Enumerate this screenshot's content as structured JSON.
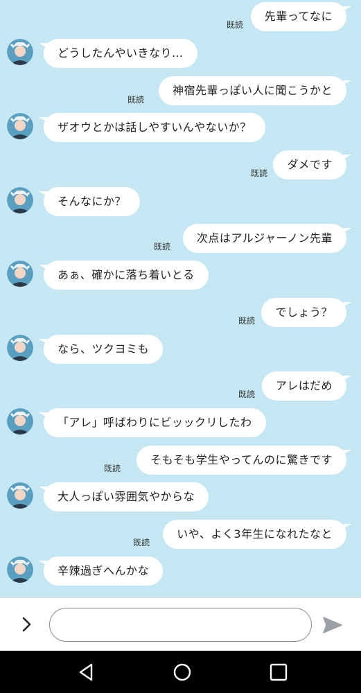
{
  "read_label": "既読",
  "messages": [
    {
      "side": "sent",
      "text": "先輩ってなに"
    },
    {
      "side": "recv",
      "text": "どうしたんやいきなり…"
    },
    {
      "side": "sent",
      "text": "神宿先輩っぽい人に聞こうかと"
    },
    {
      "side": "recv",
      "text": "ザオウとかは話しやすいんやないか？"
    },
    {
      "side": "sent",
      "text": "ダメです"
    },
    {
      "side": "recv",
      "text": "そんなにか？"
    },
    {
      "side": "sent",
      "text": "次点はアルジャーノン先輩"
    },
    {
      "side": "recv",
      "text": "あぁ、確かに落ち着いとる"
    },
    {
      "side": "sent",
      "text": "でしょう？"
    },
    {
      "side": "recv",
      "text": "なら、ツクヨミも"
    },
    {
      "side": "sent",
      "text": "アレはだめ"
    },
    {
      "side": "recv",
      "text": "「アレ」呼ばわりにビッックリしたわ"
    },
    {
      "side": "sent",
      "text": "そもそも学生やってんのに驚きです"
    },
    {
      "side": "recv",
      "text": "大人っぽい雰囲気やからな"
    },
    {
      "side": "sent",
      "text": "いや、よく3年生になれたなと"
    },
    {
      "side": "recv",
      "text": "辛辣過ぎへんかな"
    }
  ],
  "input": {
    "value": "",
    "placeholder": ""
  },
  "colors": {
    "background": "#c5e7f3",
    "bubble": "#ffffff",
    "send_icon": "#9aa0a6"
  },
  "icons": {
    "expand": "chevron-right-icon",
    "send": "send-icon",
    "back": "back-icon",
    "home": "home-icon",
    "recents": "recents-icon"
  }
}
